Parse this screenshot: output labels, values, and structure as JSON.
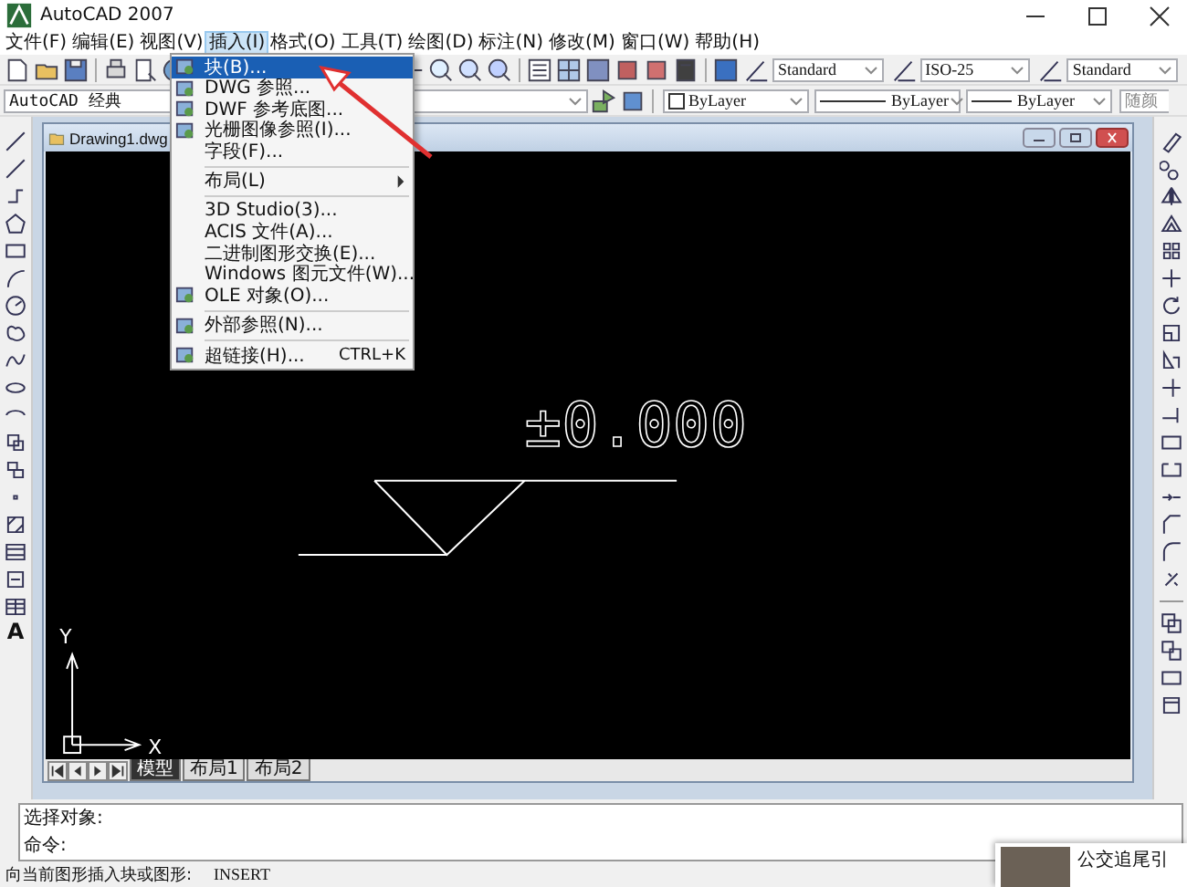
{
  "window": {
    "title": "AutoCAD 2007"
  },
  "menu": [
    {
      "label": "文件(F)",
      "selected": false
    },
    {
      "label": "编辑(E)",
      "selected": false
    },
    {
      "label": "视图(V)",
      "selected": false
    },
    {
      "label": "插入(I)",
      "selected": true
    },
    {
      "label": "格式(O)",
      "selected": false
    },
    {
      "label": "工具(T)",
      "selected": false
    },
    {
      "label": "绘图(D)",
      "selected": false
    },
    {
      "label": "标注(N)",
      "selected": false
    },
    {
      "label": "修改(M)",
      "selected": false
    },
    {
      "label": "窗口(W)",
      "selected": false
    },
    {
      "label": "帮助(H)",
      "selected": false
    }
  ],
  "insert_menu": {
    "sections": [
      {
        "items": [
          {
            "label": "块(B)...",
            "selected": true,
            "icon": true
          },
          {
            "label": "DWG 参照...",
            "selected": false,
            "icon": true
          },
          {
            "label": "DWF 参考底图...",
            "selected": false,
            "icon": true
          },
          {
            "label": "光栅图像参照(I)...",
            "selected": false,
            "icon": true
          },
          {
            "label": "字段(F)...",
            "selected": false,
            "icon": false
          }
        ]
      },
      {
        "items": [
          {
            "label": "布局(L)",
            "selected": false,
            "icon": false,
            "submenu": true
          }
        ]
      },
      {
        "items": [
          {
            "label": "3D Studio(3)...",
            "selected": false,
            "icon": false
          },
          {
            "label": "ACIS 文件(A)...",
            "selected": false,
            "icon": false
          },
          {
            "label": "二进制图形交换(E)...",
            "selected": false,
            "icon": false
          },
          {
            "label": "Windows 图元文件(W)...",
            "selected": false,
            "icon": false
          },
          {
            "label": "OLE 对象(O)...",
            "selected": false,
            "icon": true
          }
        ]
      },
      {
        "items": [
          {
            "label": "外部参照(N)...",
            "selected": false,
            "icon": true
          }
        ]
      },
      {
        "items": [
          {
            "label": "超链接(H)...",
            "selected": false,
            "icon": true,
            "shortcut": "CTRL+K"
          }
        ]
      }
    ]
  },
  "styles_toolbar": [
    {
      "value": "Standard"
    },
    {
      "value": "ISO-25"
    },
    {
      "value": "Standard"
    }
  ],
  "workspace": {
    "value": "AutoCAD 经典"
  },
  "properties_toolbar": {
    "color_value": "ByLayer",
    "linetype": "ByLayer",
    "lineweight": "ByLayer",
    "plot_style": "随颜"
  },
  "left_toolbar": {
    "text_tool": "A"
  },
  "drawing": {
    "title": "Drawing1.dwg",
    "elevation_text": "±0.000",
    "x_axis": "X",
    "y_axis": "Y",
    "tabs": [
      {
        "label": "模型",
        "selected": true
      },
      {
        "label": "布局1",
        "selected": false
      },
      {
        "label": "布局2",
        "selected": false
      }
    ]
  },
  "command_lines": [
    "选择对象:",
    "命令:"
  ],
  "status_bar": {
    "prompt": "向当前图形插入块或图形:",
    "command": "INSERT"
  },
  "notification": {
    "title": "公交追尾引"
  }
}
